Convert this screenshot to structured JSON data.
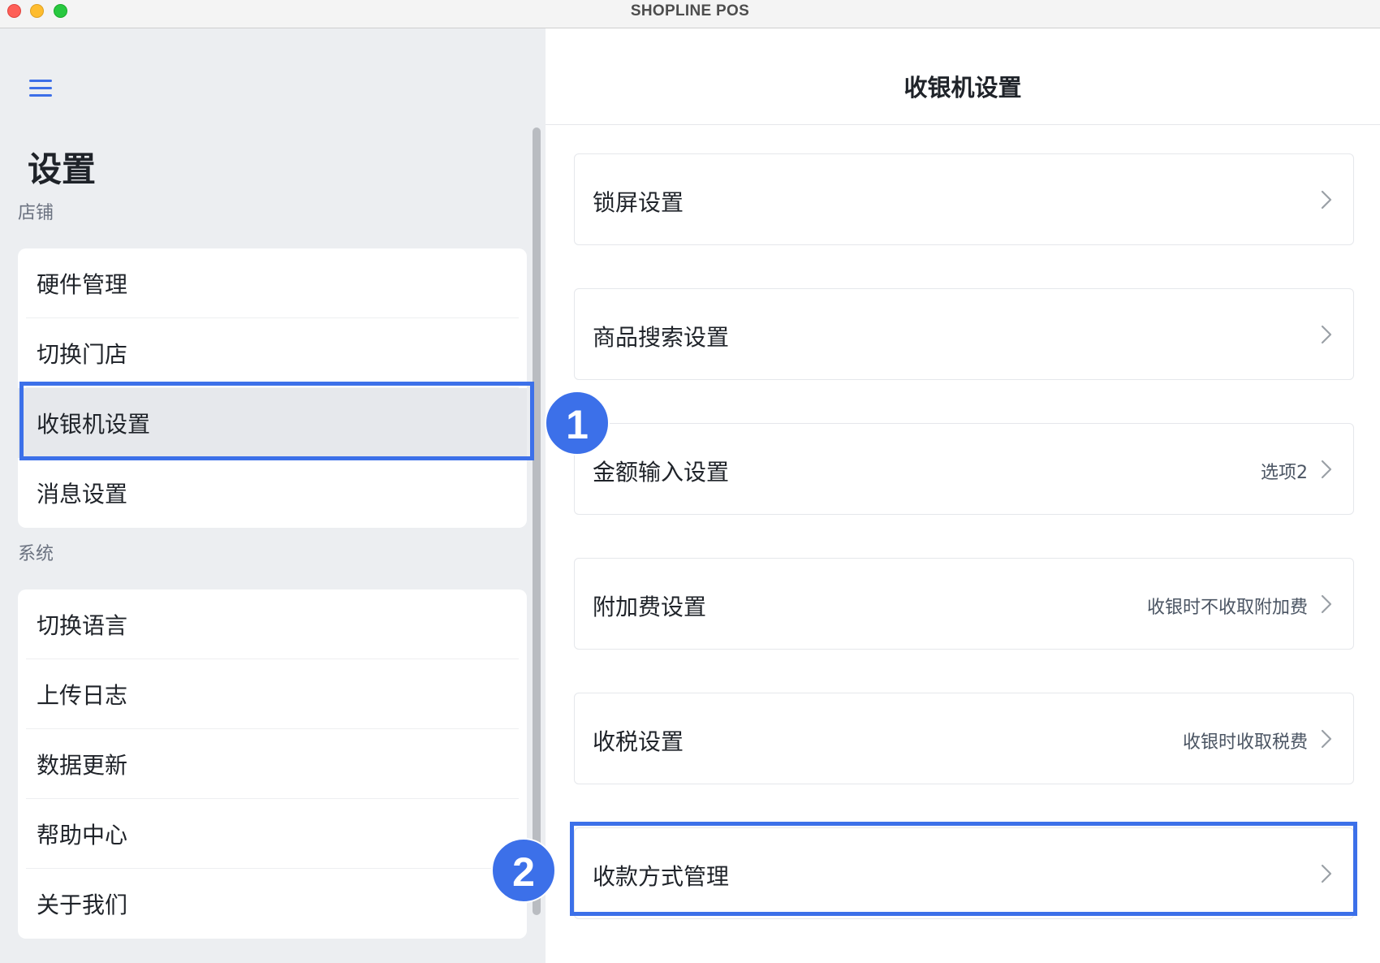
{
  "window": {
    "title": "SHOPLINE POS"
  },
  "sidebar": {
    "title": "设置",
    "groups": [
      {
        "label": "店铺",
        "items": [
          {
            "label": "硬件管理"
          },
          {
            "label": "切换门店"
          },
          {
            "label": "收银机设置"
          },
          {
            "label": "消息设置"
          }
        ]
      },
      {
        "label": "系统",
        "items": [
          {
            "label": "切换语言"
          },
          {
            "label": "上传日志"
          },
          {
            "label": "数据更新"
          },
          {
            "label": "帮助中心"
          },
          {
            "label": "关于我们"
          }
        ]
      }
    ],
    "selected": "收银机设置"
  },
  "main": {
    "title": "收银机设置",
    "rows": [
      {
        "label": "锁屏设置",
        "value": ""
      },
      {
        "label": "商品搜索设置",
        "value": ""
      },
      {
        "label": "金额输入设置",
        "value": "选项2"
      },
      {
        "label": "附加费设置",
        "value": "收银时不收取附加费"
      },
      {
        "label": "收税设置",
        "value": "收银时收取税费"
      },
      {
        "label": "收款方式管理",
        "value": ""
      }
    ]
  },
  "annotations": {
    "step1": "1",
    "step2": "2"
  },
  "colors": {
    "accent": "#3c70e9",
    "sidebar_bg": "#eceef1",
    "selected_bg": "#e6e8ec"
  },
  "icons": {
    "menu": "hamburger-icon",
    "row_arrow": "chevron-right-icon"
  }
}
